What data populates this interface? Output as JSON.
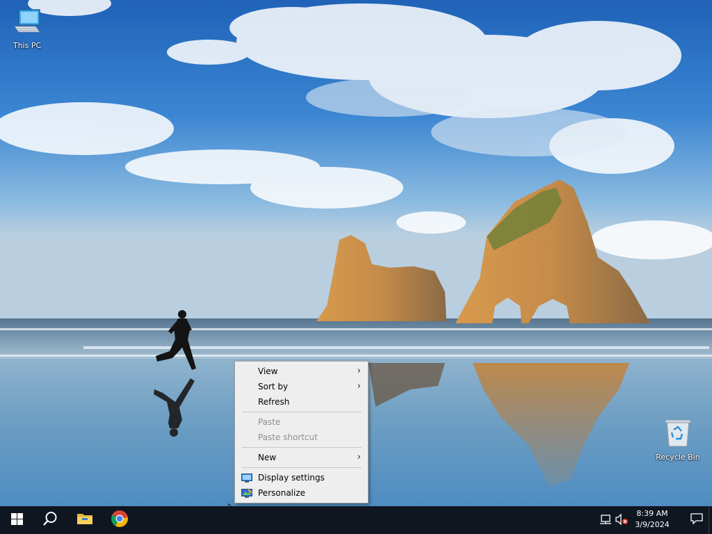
{
  "desktop": {
    "icons": [
      {
        "label": "This PC",
        "icon": "computer-icon"
      },
      {
        "label": "Recycle Bin",
        "icon": "recycle-bin-icon"
      }
    ]
  },
  "context_menu": {
    "view": "View",
    "sort_by": "Sort by",
    "refresh": "Refresh",
    "paste": "Paste",
    "paste_shortcut": "Paste shortcut",
    "new": "New",
    "display_settings": "Display settings",
    "personalize": "Personalize",
    "submenu_arrow": "›"
  },
  "taskbar": {
    "pinned": [
      {
        "name": "start",
        "icon": "windows-logo-icon"
      },
      {
        "name": "search",
        "icon": "search-icon"
      },
      {
        "name": "file-explorer",
        "icon": "folder-icon"
      },
      {
        "name": "chrome",
        "icon": "chrome-icon"
      }
    ],
    "tray": {
      "network_icon": "network-disconnected-icon",
      "volume_icon": "volume-muted-icon",
      "time": "8:39 AM",
      "date": "3/9/2024",
      "notification_icon": "action-center-icon"
    }
  },
  "colors": {
    "taskbar": "#101620",
    "menu_bg": "#eeeeee",
    "menu_disabled_text": "#8f8f8f"
  }
}
